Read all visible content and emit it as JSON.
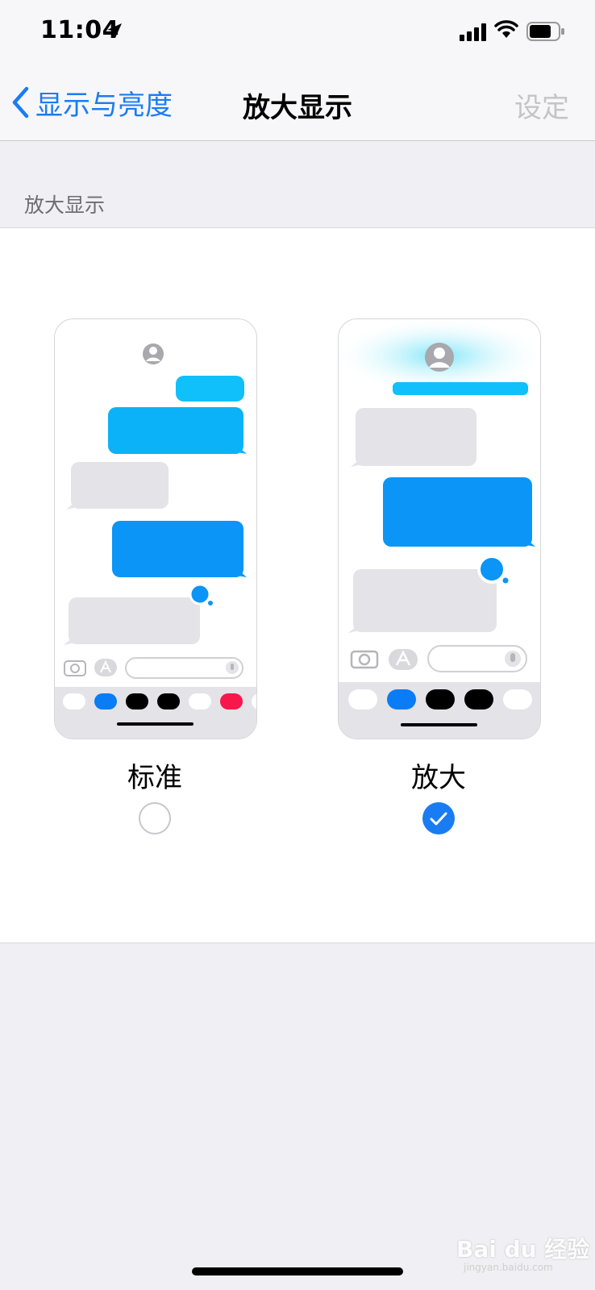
{
  "status": {
    "time": "11:04"
  },
  "nav": {
    "back_label": "显示与亮度",
    "title": "放大显示",
    "action_label": "设定"
  },
  "section": {
    "header": "放大显示"
  },
  "options": [
    {
      "label": "标准",
      "selected": false
    },
    {
      "label": "放大",
      "selected": true
    }
  ],
  "watermark": {
    "brand": "Bai du 经验",
    "sub": "jingyan.baidu.com"
  },
  "colors": {
    "accent": "#1a7cf3",
    "bubble_blue": "#0aa8f8",
    "bubble_gray": "#e3e3e8"
  }
}
